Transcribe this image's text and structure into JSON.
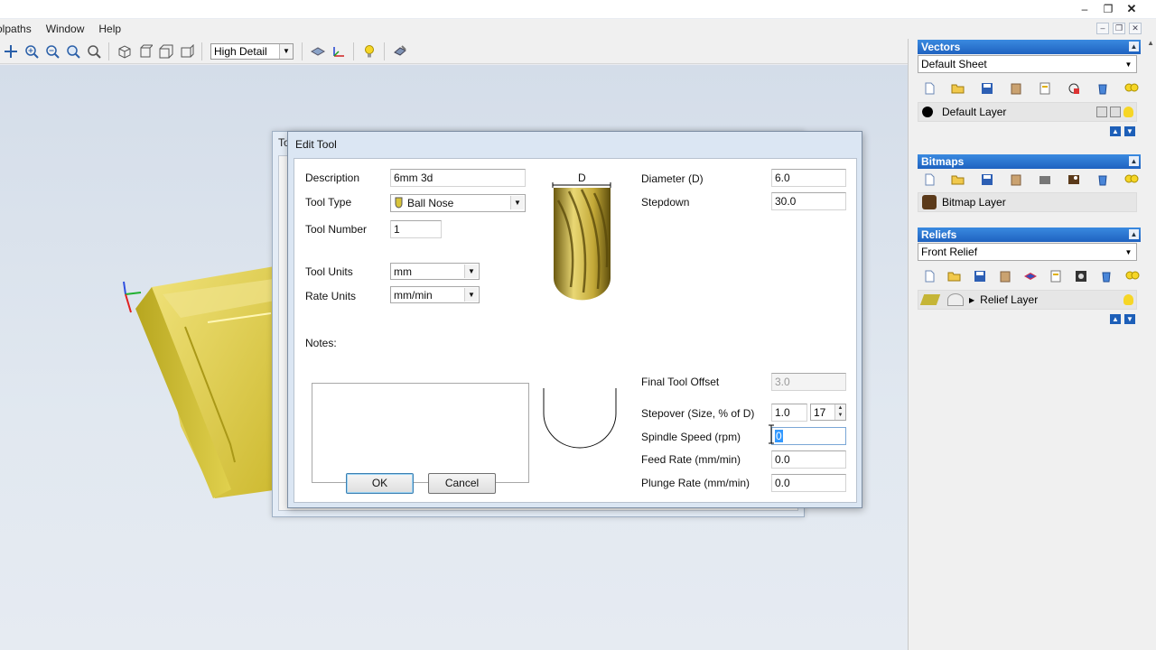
{
  "menu": {
    "items": [
      "olpaths",
      "Window",
      "Help"
    ]
  },
  "toolbar": {
    "detail_select": "High Detail"
  },
  "bg_window": {
    "title": "To"
  },
  "dialog": {
    "title": "Edit Tool",
    "description_label": "Description",
    "description_value": "6mm 3d",
    "tool_type_label": "Tool Type",
    "tool_type_value": "Ball Nose",
    "tool_number_label": "Tool Number",
    "tool_number_value": "1",
    "tool_units_label": "Tool Units",
    "tool_units_value": "mm",
    "rate_units_label": "Rate Units",
    "rate_units_value": "mm/min",
    "notes_label": "Notes:",
    "diagram_label": "D",
    "diameter_label": "Diameter (D)",
    "diameter_value": "6.0",
    "stepdown_label": "Stepdown",
    "stepdown_value": "30.0",
    "final_offset_label": "Final Tool Offset",
    "final_offset_value": "3.0",
    "stepover_label": "Stepover (Size, % of D)",
    "stepover_size": "1.0",
    "stepover_percent": "17",
    "spindle_label": "Spindle Speed (rpm)",
    "spindle_value": "0",
    "feed_label": "Feed Rate (mm/min)",
    "feed_value": "0.0",
    "plunge_label": "Plunge Rate (mm/min)",
    "plunge_value": "0.0",
    "ok_label": "OK",
    "cancel_label": "Cancel"
  },
  "panel": {
    "vectors": {
      "title": "Vectors",
      "sheet": "Default Sheet",
      "layer": "Default Layer"
    },
    "bitmaps": {
      "title": "Bitmaps",
      "layer": "Bitmap Layer"
    },
    "reliefs": {
      "title": "Reliefs",
      "relief": "Front Relief",
      "layer": "Relief Layer"
    }
  },
  "colors": {
    "section_header": "#2a74d6",
    "relief_gold": "#d8c63a",
    "viewport_bg": "#dbe3ed"
  }
}
